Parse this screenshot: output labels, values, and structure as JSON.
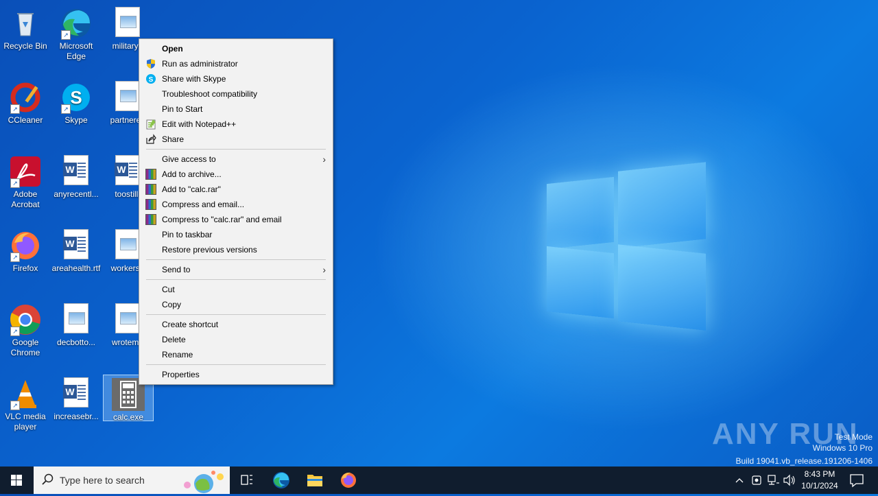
{
  "desktop": {
    "icons": [
      {
        "label": "Recycle Bin"
      },
      {
        "label": "Microsoft Edge"
      },
      {
        "label": "militaryn"
      },
      {
        "label": "CCleaner"
      },
      {
        "label": "Skype"
      },
      {
        "label": "partnerex"
      },
      {
        "label": "Adobe Acrobat"
      },
      {
        "label": "anyrecentl..."
      },
      {
        "label": "toostill."
      },
      {
        "label": "Firefox"
      },
      {
        "label": "areahealth.rtf"
      },
      {
        "label": "workersn"
      },
      {
        "label": "Google Chrome"
      },
      {
        "label": "decbotto..."
      },
      {
        "label": "wrotema"
      },
      {
        "label": "VLC media player"
      },
      {
        "label": "increasebr..."
      },
      {
        "label": "calc.exe"
      }
    ]
  },
  "context_menu": {
    "items": [
      "Open",
      "Run as administrator",
      "Share with Skype",
      "Troubleshoot compatibility",
      "Pin to Start",
      "Edit with Notepad++",
      "Share",
      "Give access to",
      "Add to archive...",
      "Add to \"calc.rar\"",
      "Compress and email...",
      "Compress to \"calc.rar\" and email",
      "Pin to taskbar",
      "Restore previous versions",
      "Send to",
      "Cut",
      "Copy",
      "Create shortcut",
      "Delete",
      "Rename",
      "Properties"
    ]
  },
  "watermark": {
    "brand": "ANY RUN",
    "line1": "Test Mode",
    "line2": "Windows 10 Pro",
    "line3": "Build 19041.vb_release.191206-1406"
  },
  "taskbar": {
    "search_placeholder": "Type here to search",
    "time": "8:43 PM",
    "date": "10/1/2024"
  },
  "colors": {
    "accent": "#0078d7",
    "taskbar": "#101d2e",
    "menu_bg": "#f2f2f2"
  }
}
